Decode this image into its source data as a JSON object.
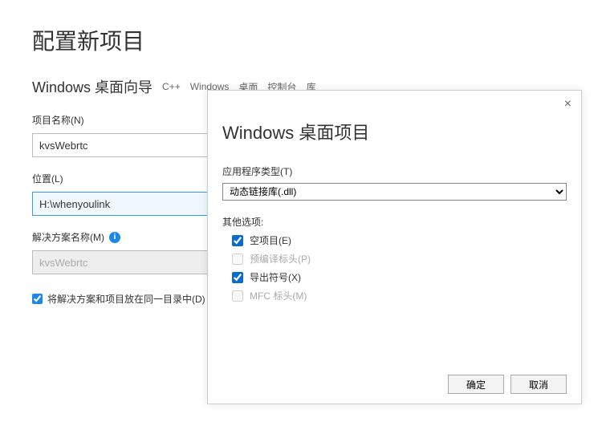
{
  "main": {
    "title": "配置新项目",
    "wizard": "Windows 桌面向导",
    "tags": [
      "C++",
      "Windows",
      "桌面",
      "控制台",
      "库"
    ],
    "projectNameLabel": "项目名称(N)",
    "projectNameValue": "kvsWebrtc",
    "locationLabel": "位置(L)",
    "locationValue": "H:\\whenyoulink",
    "solutionNameLabel": "解决方案名称(M)",
    "solutionNameValue": "kvsWebrtc",
    "sameDirLabel": "将解决方案和项目放在同一目录中(D)",
    "sameDirChecked": true
  },
  "dialog": {
    "title": "Windows 桌面项目",
    "appTypeLabel": "应用程序类型(T)",
    "appTypeValue": "动态链接库(.dll)",
    "otherOptionsLabel": "其他选项:",
    "options": [
      {
        "label": "空项目(E)",
        "checked": true,
        "disabled": false
      },
      {
        "label": "预编译标头(P)",
        "checked": false,
        "disabled": true
      },
      {
        "label": "导出符号(X)",
        "checked": true,
        "disabled": false
      },
      {
        "label": "MFC 标头(M)",
        "checked": false,
        "disabled": true
      }
    ],
    "okLabel": "确定",
    "cancelLabel": "取消",
    "closeLabel": "×"
  }
}
